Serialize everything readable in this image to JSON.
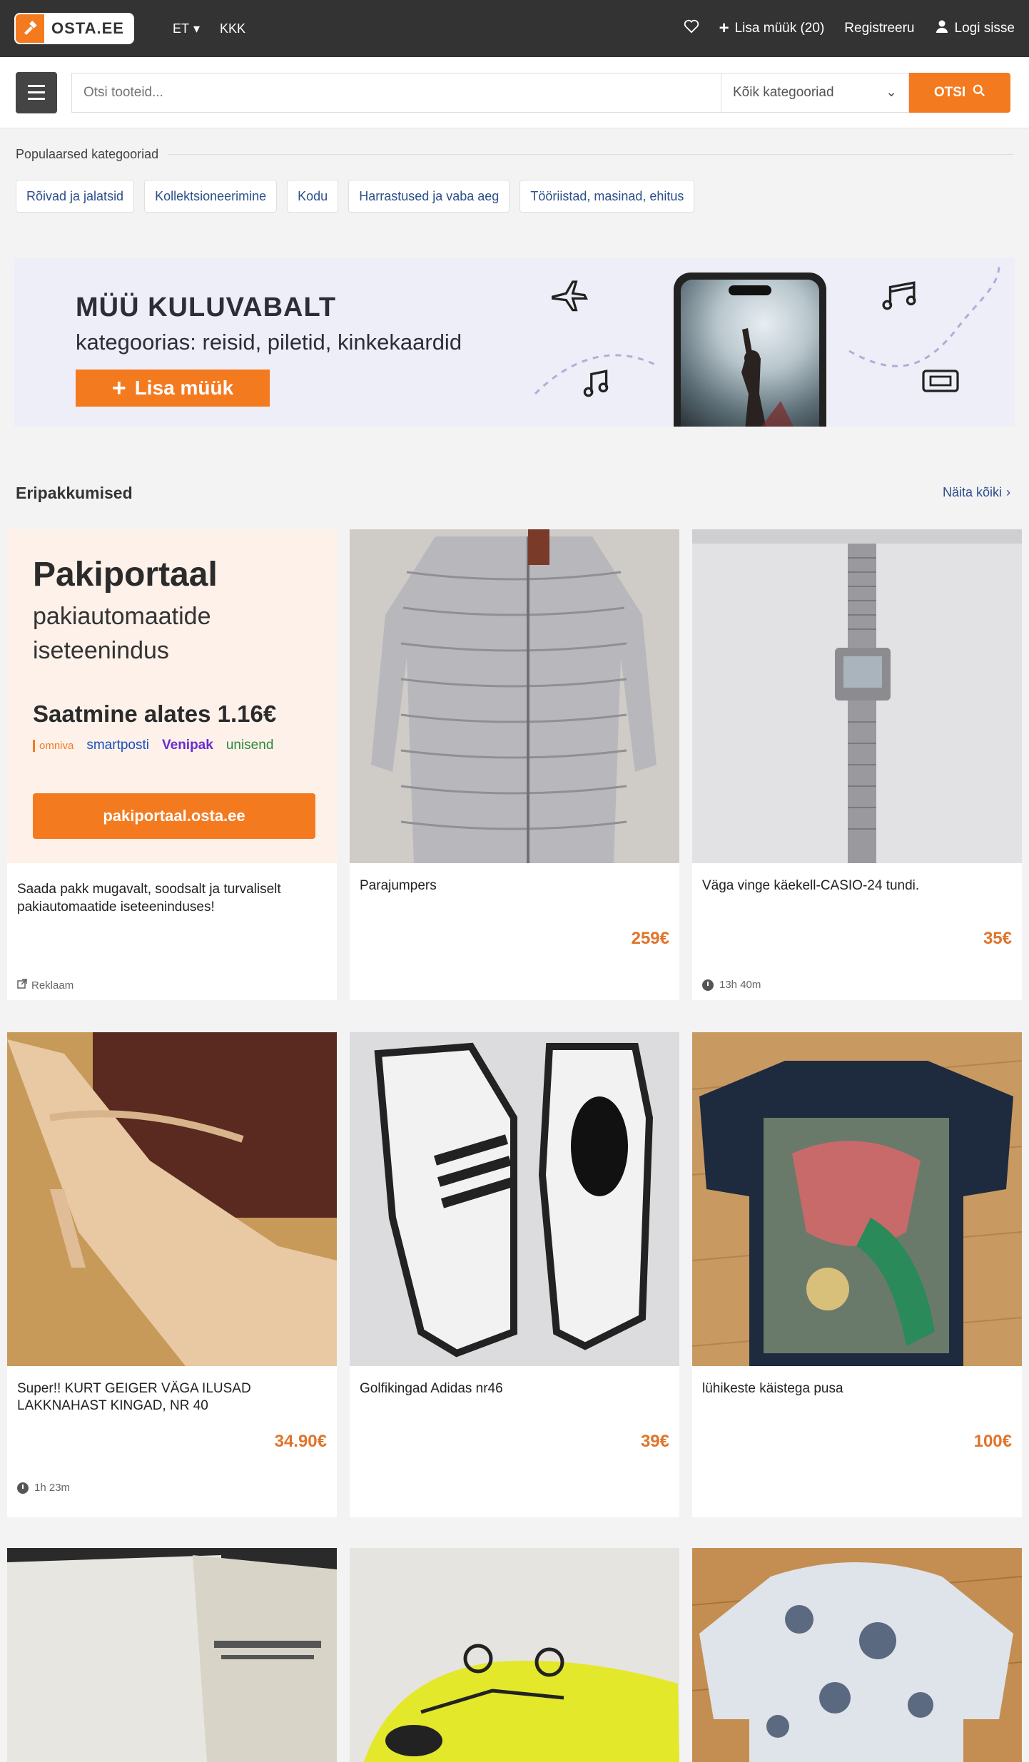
{
  "topbar": {
    "logo_text": "OSTA.EE",
    "language": "ET",
    "currency": "KKK",
    "add_sale": "Lisa müük (20)",
    "register": "Registreeru",
    "login": "Logi sisse"
  },
  "search": {
    "placeholder": "Otsi tooteid...",
    "category": "Kõik kategooriad",
    "button": "OTSI"
  },
  "popular": {
    "title": "Populaarsed kategooriad",
    "chips": [
      "Rõivad ja jalatsid",
      "Kollektsioneerimine",
      "Kodu",
      "Harrastused ja vaba aeg",
      "Tööriistad, masinad, ehitus"
    ]
  },
  "banner": {
    "headline": "MÜÜ KULUVABALT",
    "subline": "kategoorias: reisid, piletid, kinkekaardid",
    "button": "Lisa müük"
  },
  "offers": {
    "title": "Eripakkumised",
    "see_all": "Näita kõiki"
  },
  "ad": {
    "title": "Pakiportaal",
    "subtitle_1": "pakiautomaatide",
    "subtitle_2": "iseteenindus",
    "shipping": "Saatmine alates 1.16€",
    "carriers": [
      "omniva",
      "smartposti",
      "Venipak",
      "unisend"
    ],
    "button": "pakiportaal.osta.ee",
    "description": "Saada pakk mugavalt, soodsalt ja turvaliselt pakiautomaatide iseteeninduses!",
    "label": "Reklaam"
  },
  "products": [
    {
      "title": "Parajumpers",
      "price": "259€",
      "time": ""
    },
    {
      "title": "Väga vinge käekell-CASIO-24 tundi.",
      "price": "35€",
      "time": "13h 40m"
    },
    {
      "title": "Super!! KURT GEIGER VÄGA ILUSAD LAKKNAHAST KINGAD, NR 40",
      "price": "34.90€",
      "time": "1h 23m"
    },
    {
      "title": "Golfikingad Adidas nr46",
      "price": "39€",
      "time": ""
    },
    {
      "title": "lühikeste käistega pusa",
      "price": "100€",
      "time": ""
    }
  ]
}
